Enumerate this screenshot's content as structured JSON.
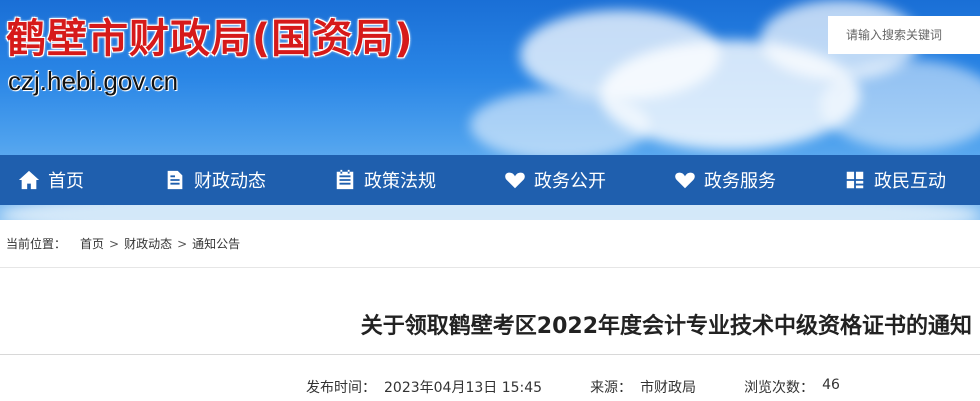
{
  "header": {
    "title": "鹤壁市财政局(国资局)",
    "domain": "czj.hebi.gov.cn",
    "search": {
      "placeholder": "请输入搜索关键词",
      "icon": "search-field"
    }
  },
  "nav": {
    "items": [
      {
        "label": "首页",
        "icon": "home-icon"
      },
      {
        "label": "财政动态",
        "icon": "document-icon"
      },
      {
        "label": "政策法规",
        "icon": "list-icon"
      },
      {
        "label": "政务公开",
        "icon": "heart-icon"
      },
      {
        "label": "政务服务",
        "icon": "heart-icon"
      },
      {
        "label": "政民互动",
        "icon": "grid-icon"
      }
    ]
  },
  "breadcrumb": {
    "label": "当前位置：",
    "items": [
      "首页",
      "财政动态",
      "通知公告"
    ],
    "separator": ">"
  },
  "article": {
    "title": "关于领取鹤壁考区2022年度会计专业技术中级资格证书的通知",
    "meta": {
      "publish_label": "发布时间：",
      "publish_time": "2023年04月13日 15:45",
      "source_label": "来源：",
      "source": "市财政局",
      "views_label": "浏览次数：",
      "views": "46"
    }
  },
  "colors": {
    "title_red": "#d61a1a",
    "nav_blue": "#1f5fae",
    "sky_blue": "#2a86e6"
  }
}
